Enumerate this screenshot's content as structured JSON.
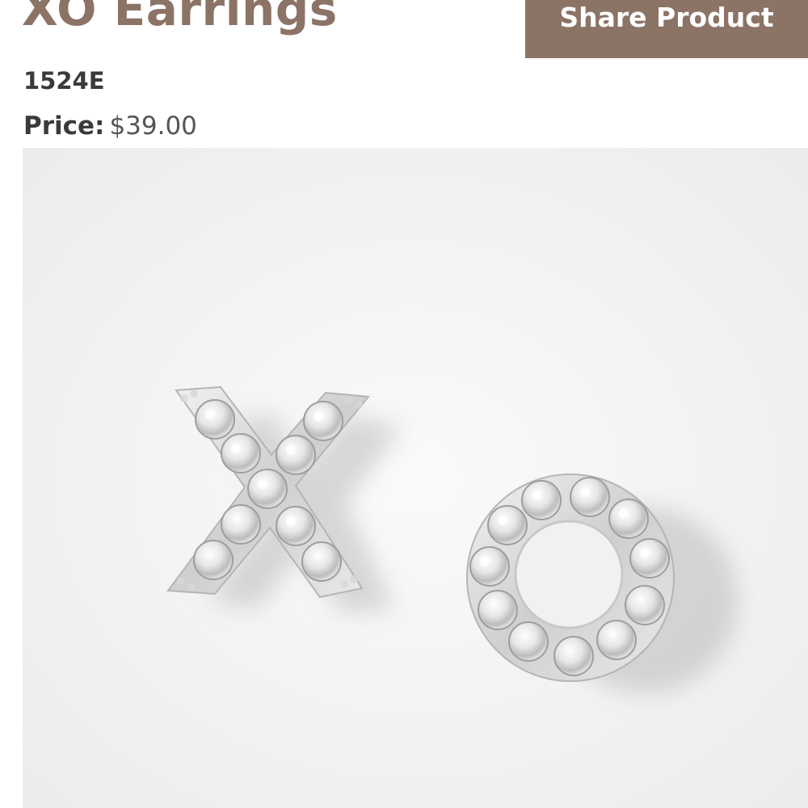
{
  "product": {
    "title": "XO Earrings",
    "sku": "1524E",
    "price_label": "Price:",
    "price_value": "$39.00"
  },
  "actions": {
    "share_label": "Share Product"
  },
  "colors": {
    "accent": "#8b7366",
    "image_background": "#f3f3f3",
    "text_dark": "#3a3a3a"
  },
  "image": {
    "icon": "xo-stud-earrings-image"
  }
}
